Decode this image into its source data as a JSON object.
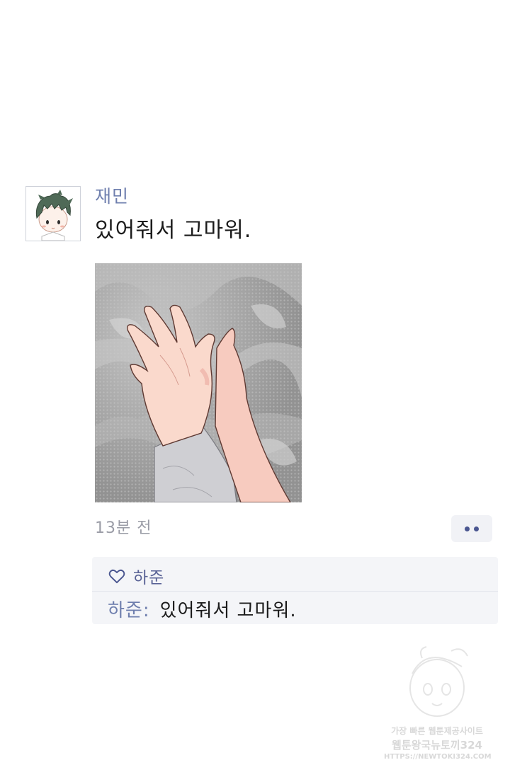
{
  "post": {
    "author": "재민",
    "message": "있어줘서 고마워.",
    "timestamp": "13분 전",
    "avatar_icon": "boy-avatar-icon",
    "photo_icon": "holding-hands-illustration",
    "more_icon": "more-dots-icon"
  },
  "reactions": {
    "like_icon": "heart-outline-icon",
    "liked_by": "하준"
  },
  "comments": [
    {
      "author": "하준",
      "separator": ":",
      "text": "있어줘서 고마워."
    }
  ],
  "watermark": {
    "line1": "가장 빠른 웹툰제공사이트",
    "line2": "웹툰왕국뉴토끼324",
    "line3": "HTTPS://NEWTOKI324.COM"
  },
  "colors": {
    "accent": "#6f7fae",
    "dots": "#4a5690",
    "comment_bg": "#f4f5f8"
  }
}
